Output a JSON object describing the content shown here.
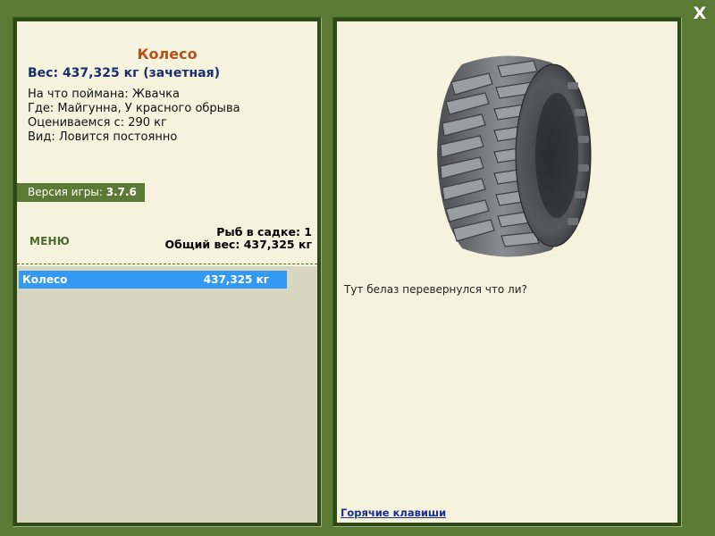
{
  "window": {
    "close_label": "X"
  },
  "fish": {
    "name": "Колесо",
    "weight_line": "Вес: 437,325 кг (зачетная)",
    "bait_line": "На что поймана: Жвачка",
    "location_line": "Где: Майгунна, У красного обрыва",
    "rated_line": "Оцениваемся с: 290 кг",
    "type_line": "Вид: Ловится постоянно",
    "description": "Тут белаз перевернулся что ли?",
    "image_icon": "tractor-tire-image"
  },
  "version": {
    "label": "Версия игры:",
    "value": "3.7.6"
  },
  "menu": {
    "label": "МЕНЮ"
  },
  "keepnet": {
    "count_line": "Рыб в садке: 1",
    "total_line": "Общий вес: 437,325 кг",
    "items": [
      {
        "name": "Колесо",
        "weight": "437,325 кг",
        "selected": true
      }
    ]
  },
  "footer": {
    "hotkeys_label": "Горячие клавиши"
  },
  "colors": {
    "frame_green": "#5a7a36",
    "panel_cream": "#f5f3dd",
    "list_bg": "#d8d6bf",
    "title_orange": "#b5501a",
    "weight_navy": "#1a2e6e",
    "selection_blue": "#3399f3"
  }
}
